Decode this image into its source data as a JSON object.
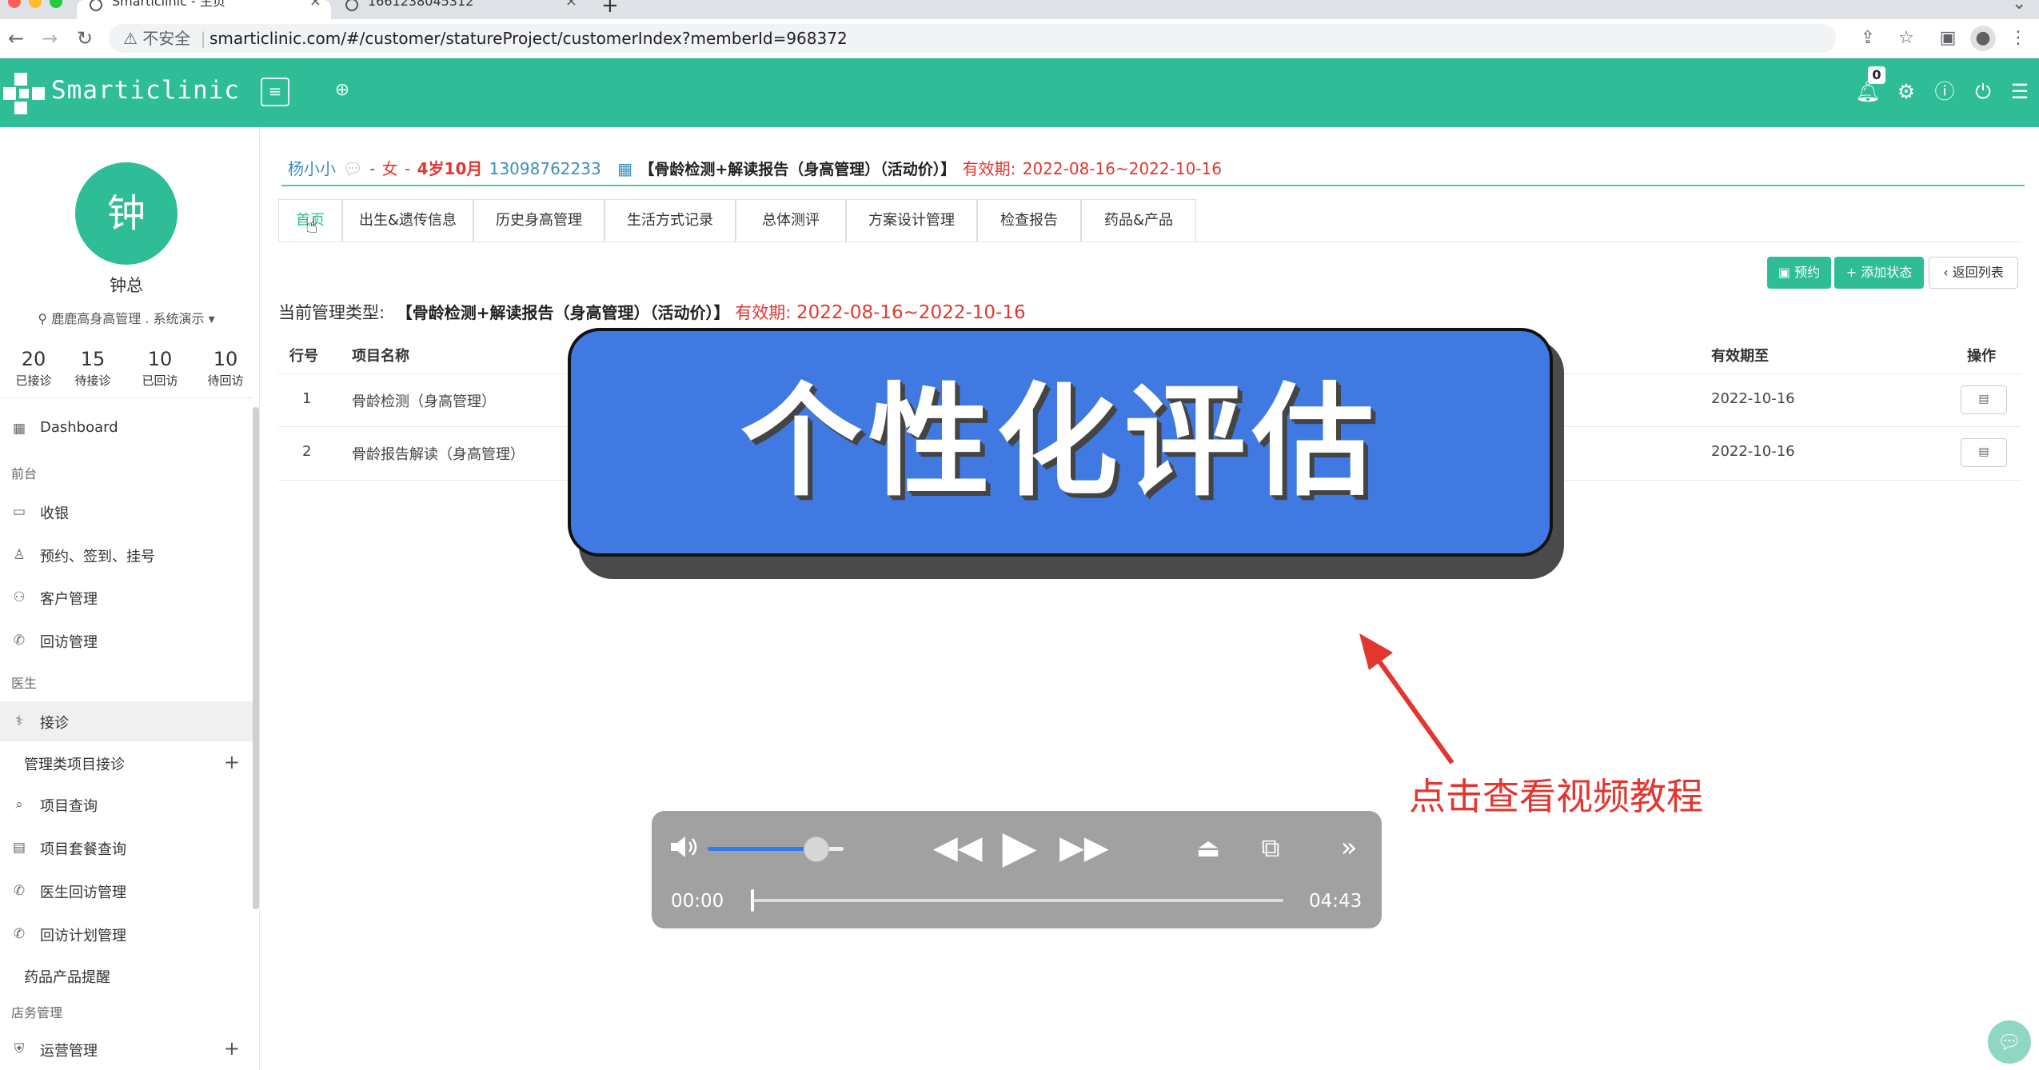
{
  "browser": {
    "tabs": [
      {
        "title": "Smarticlinic - 主页",
        "active": true
      },
      {
        "title": "1661238045312",
        "active": false
      }
    ],
    "new_tab_label": "+",
    "security_label": "不安全",
    "url": "smarticlinic.com/#/customer/statureProject/customerIndex?memberId=968372"
  },
  "header": {
    "brand": "Smarticlinic",
    "notification_count": "0"
  },
  "sidebar": {
    "avatar_char": "钟",
    "user_name": "钟总",
    "org": "鹿鹿高身高管理 . 系统演示",
    "stats": [
      {
        "value": "20",
        "label": "已接诊"
      },
      {
        "value": "15",
        "label": "待接诊"
      },
      {
        "value": "10",
        "label": "已回访"
      },
      {
        "value": "10",
        "label": "待回访"
      }
    ],
    "dashboard": "Dashboard",
    "section_front": "前台",
    "front_items": [
      "收银",
      "预约、签到、挂号",
      "客户管理",
      "回访管理"
    ],
    "section_doctor": "医生",
    "doctor_active": "接诊",
    "doctor_sub": "管理类项目接诊",
    "doctor_items": [
      "项目查询",
      "项目套餐查询",
      "医生回访管理",
      "回访计划管理"
    ],
    "drug_reminder": "药品产品提醒",
    "section_store": "店务管理",
    "ops": "运营管理"
  },
  "customer": {
    "name": "杨小小",
    "sep": " - ",
    "gender": "女",
    "age": "4岁10月",
    "phone": "13098762233",
    "project": "【骨龄检测+解读报告（身高管理）（活动价）】",
    "valid_label": "有效期:",
    "valid_range": "2022-08-16~2022-10-16"
  },
  "tabs": [
    "首页",
    "出生&遗传信息",
    "历史身高管理",
    "生活方式记录",
    "总体测评",
    "方案设计管理",
    "检查报告",
    "药品&产品"
  ],
  "actions": {
    "book": "预约",
    "add_status": "添加状态",
    "back": "返回列表"
  },
  "current_type": {
    "label": "当前管理类型:",
    "project": "【骨龄检测+解读报告（身高管理）（活动价）】",
    "valid_label": "有效期:",
    "valid_range": "2022-08-16~2022-10-16"
  },
  "table": {
    "headers": {
      "no": "行号",
      "name": "项目名称",
      "valid_to": "有效期至",
      "op": "操作"
    },
    "rows": [
      {
        "no": "1",
        "name": "骨龄检测（身高管理）",
        "valid_to": "2022-10-16"
      },
      {
        "no": "2",
        "name": "骨龄报告解读（身高管理）",
        "valid_to": "2022-10-16"
      }
    ]
  },
  "overlay": {
    "banner": "个性化评估",
    "hint": "点击查看视频教程"
  },
  "player": {
    "volume": 0.8,
    "current_time": "00:00",
    "duration": "04:43",
    "progress": 0.0
  },
  "colors": {
    "primary": "#2ebd96",
    "banner": "#4079e1",
    "danger": "#e3362f"
  }
}
